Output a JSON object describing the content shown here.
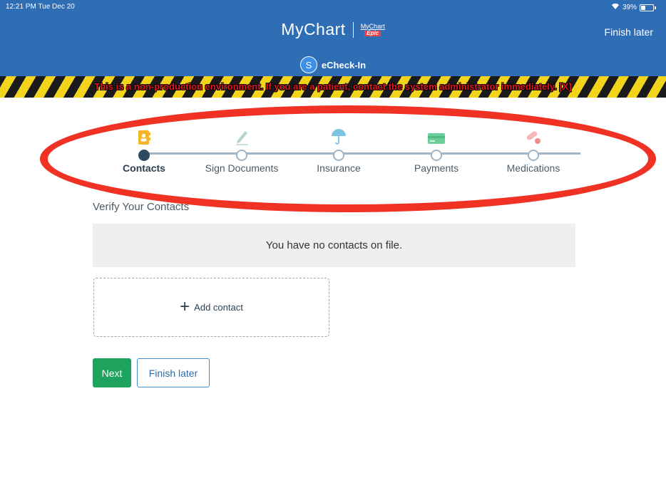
{
  "status_bar": {
    "time": "12:21 PM  Tue Dec 20",
    "battery": "39%",
    "battery_level": 0.39
  },
  "header": {
    "logo": "MyChart",
    "badge_top": "MyChart",
    "badge_bottom": "Epic",
    "finish_later": "Finish later",
    "echeckin_avatar": "S",
    "echeckin_label": "eCheck-In",
    "bg_color": "#2f6eb5"
  },
  "warning": {
    "text": "This is a non-production environment. If you are a patient, contact the system administrator immediately. [X]"
  },
  "steps": [
    {
      "label": "Contacts",
      "icon": "address-book-icon",
      "active": true
    },
    {
      "label": "Sign Documents",
      "icon": "pen-icon",
      "active": false
    },
    {
      "label": "Insurance",
      "icon": "umbrella-icon",
      "active": false
    },
    {
      "label": "Payments",
      "icon": "credit-card-icon",
      "active": false
    },
    {
      "label": "Medications",
      "icon": "pill-icon",
      "active": false
    }
  ],
  "section": {
    "title": "Verify Your Contacts",
    "empty_message": "You have no contacts on file.",
    "add_contact": "Add contact"
  },
  "buttons": {
    "next": "Next",
    "finish_later": "Finish later"
  },
  "colors": {
    "primary": "#2f6eb5",
    "success": "#1ea35f",
    "annotation": "#ef3223"
  }
}
